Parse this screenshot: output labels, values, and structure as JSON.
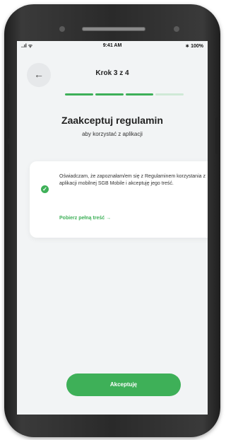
{
  "status_bar": {
    "signal": "..ıl ᯤ",
    "time": "9:41 AM",
    "battery": "∗ 100%"
  },
  "header": {
    "back_icon": "arrow-left-icon",
    "step_title": "Krok 3 z 4",
    "progress": {
      "current_step": 3,
      "total_steps": 4
    }
  },
  "main": {
    "title": "Zaakceptuj regulamin",
    "subtitle": "aby korzystać z aplikacji"
  },
  "consent_card": {
    "checked": true,
    "text": "Oświadczam, że zapoznałam/em się z Regulaminem korzystania z aplikacji mobilnej SGB Mobile i akceptuję jego treść.",
    "link_label": "Pobierz pełną treść →"
  },
  "footer": {
    "accept_label": "Akceptuję"
  },
  "colors": {
    "accent": "#3eb058",
    "accent_light": "#cfe9d6",
    "background": "#f2f4f5",
    "card": "#ffffff"
  }
}
